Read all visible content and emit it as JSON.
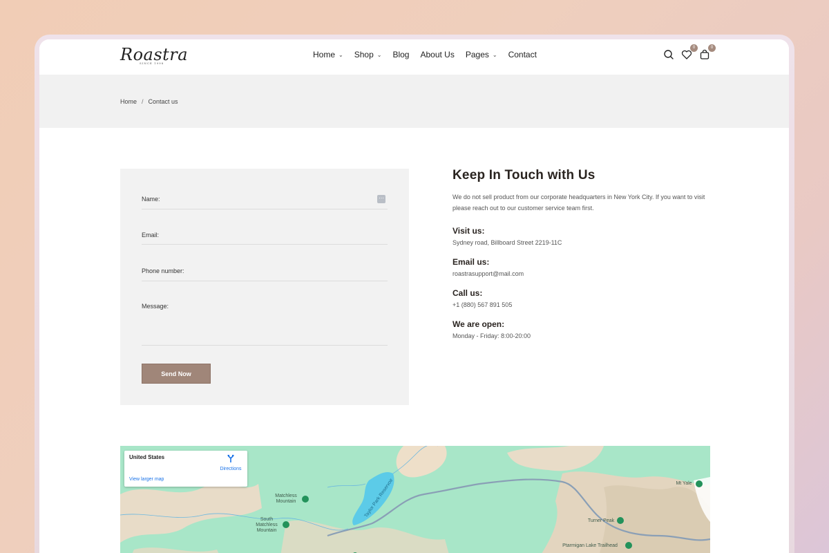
{
  "header": {
    "logo": {
      "word": "Roastra",
      "since": "SINCE 1998"
    },
    "nav": [
      {
        "label": "Home",
        "has_dropdown": true
      },
      {
        "label": "Shop",
        "has_dropdown": true
      },
      {
        "label": "Blog",
        "has_dropdown": false
      },
      {
        "label": "About Us",
        "has_dropdown": false
      },
      {
        "label": "Pages",
        "has_dropdown": true
      },
      {
        "label": "Contact",
        "has_dropdown": false
      }
    ],
    "wishlist_count": "0",
    "cart_count": "0"
  },
  "breadcrumb": {
    "home": "Home",
    "separator": "/",
    "current": "Contact us"
  },
  "form": {
    "name_label": "Name:",
    "email_label": "Email:",
    "phone_label": "Phone number:",
    "message_label": "Message:",
    "submit_label": "Send Now"
  },
  "info": {
    "heading": "Keep In Touch with Us",
    "description": "We do not sell product from our corporate headquarters in New York City. If you want to visit please reach out to our customer service team first.",
    "visit_title": "Visit us:",
    "visit_value": "Sydney road, Billboard Street 2219-11C",
    "email_title": "Email us:",
    "email_value": "roastrasupport@mail.com",
    "call_title": "Call us:",
    "call_value": "+1 (880) 567 891 505",
    "open_title": "We are open:",
    "open_value": "Monday - Friday: 8:00-20:00"
  },
  "map": {
    "card_title": "United States",
    "directions": "Directions",
    "view_larger": "View larger map",
    "labels": {
      "matchless": "Matchless Mountain",
      "south_matchless": "South Matchless Mountain",
      "reservoir": "Taylor Park Reservoir",
      "turner": "Turner Peak",
      "ptarmigan": "Ptarmigan Lake Trailhead",
      "mt_yale": "Mt Yale"
    }
  },
  "colors": {
    "accent": "#a08679",
    "badge": "#a58b7e",
    "panel": "#f2f2f2",
    "map_green": "#a8e6c8",
    "water": "#5ccbe8"
  }
}
